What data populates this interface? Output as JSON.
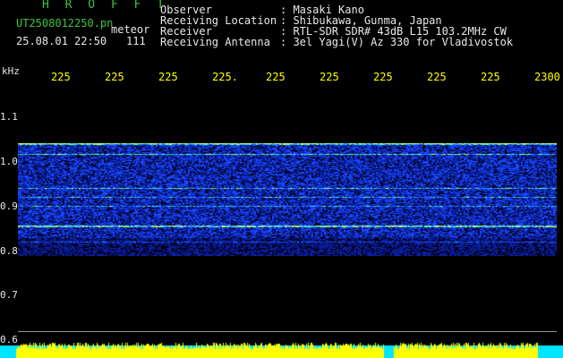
{
  "header": {
    "app_title": "H R O F F T",
    "filename": "UT2508012250.pn",
    "tag": "meteor",
    "datetime": "25.08.01 22:50",
    "count": "111"
  },
  "info": [
    {
      "label": "Observer",
      "value": ": Masaki Kano"
    },
    {
      "label": "Receiving Location",
      "value": ": Shibukawa, Gunma, Japan"
    },
    {
      "label": "Receiver",
      "value": ": RTL-SDR SDR# 43dB L15 103.2MHz CW"
    },
    {
      "label": "Receiving Antenna",
      "value": ": 3el Yagi(V) Az 330 for Vladivostok"
    }
  ],
  "axis": {
    "unit": "kHz",
    "x_ticks": [
      "225",
      "225",
      "225",
      "225.",
      "225",
      "225",
      "225",
      "225",
      "225",
      "2300"
    ],
    "y_ticks": [
      "1.1",
      "1.0",
      "0.9",
      "0.8",
      "0.7",
      "0.6"
    ]
  },
  "colors": {
    "green_text": "#3ec43e",
    "white_text": "#e8e8e8",
    "tick_yellow": "#ffff00",
    "spectrogram_blue": "#1a3cff",
    "bar_cyan": "#00e5ff",
    "bar_yellow": "#ffff00"
  }
}
